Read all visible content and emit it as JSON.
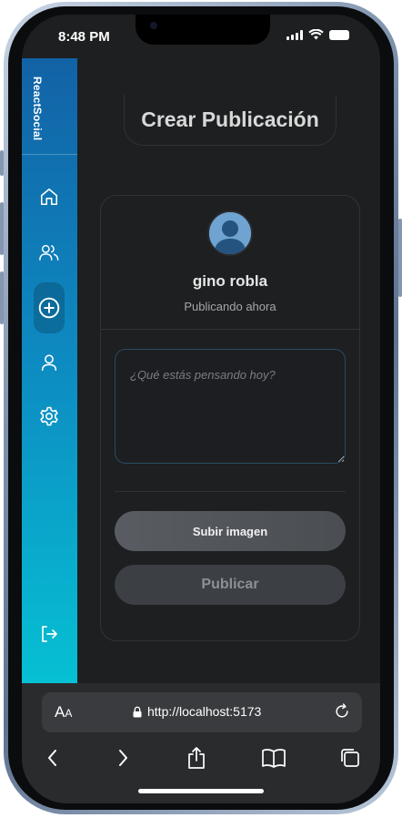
{
  "status_bar": {
    "time": "8:48 PM"
  },
  "sidebar": {
    "brand": "ReactSocial",
    "items": [
      {
        "name": "home",
        "icon": "home-icon"
      },
      {
        "name": "friends",
        "icon": "users-icon"
      },
      {
        "name": "create-post",
        "icon": "plus-circle-icon",
        "active": true
      },
      {
        "name": "profile",
        "icon": "user-icon"
      },
      {
        "name": "settings",
        "icon": "gear-icon"
      },
      {
        "name": "logout",
        "icon": "logout-icon"
      }
    ]
  },
  "main": {
    "title": "Crear Publicación",
    "card": {
      "user_name": "gino robla",
      "user_sub": "Publicando ahora",
      "post_placeholder": "¿Qué estás pensando hoy?",
      "upload_label": "Subir imagen",
      "publish_label": "Publicar"
    }
  },
  "browser": {
    "aa_label_big": "A",
    "aa_label_small": "A",
    "url": "http://localhost:5173"
  },
  "colors": {
    "sidebar_top": "#1262a6",
    "sidebar_bottom": "#06c0d3",
    "background": "#1e1f21"
  }
}
